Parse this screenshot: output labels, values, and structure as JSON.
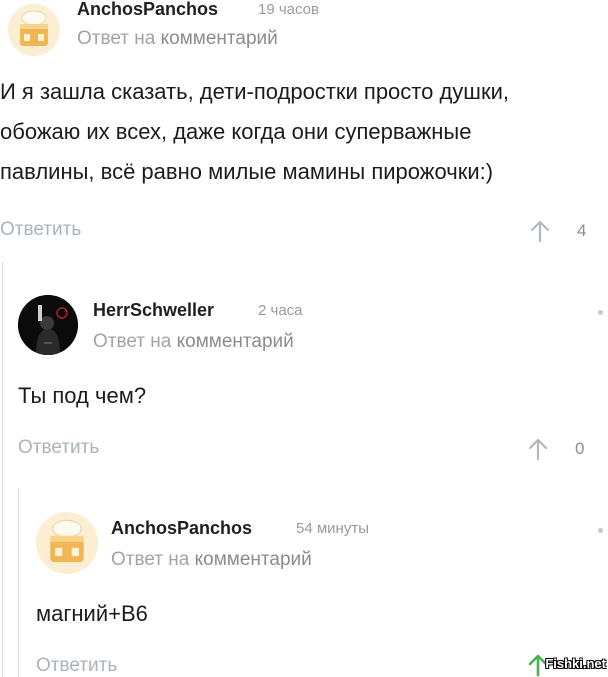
{
  "comments": [
    {
      "username": "AnchosPanchos",
      "time": "19 часов",
      "reply_prefix": "Ответ на ",
      "reply_link": "комментарий",
      "text_lines": [
        "И я зашла сказать, дети-подростки просто душки,",
        "обожаю их всех, даже когда они суперважные",
        "павлины, всё равно милые мамины пирожочки:)"
      ],
      "reply_label": "Ответить",
      "votes": "4",
      "avatar_icon": "cake-avatar-icon"
    },
    {
      "username": "HerrSchweller",
      "time": "2 часа",
      "reply_prefix": "Ответ на ",
      "reply_link": "комментарий",
      "text_lines": [
        "Ты под чем?"
      ],
      "reply_label": "Ответить",
      "votes": "0",
      "avatar_icon": "hooded-figure-avatar-icon"
    },
    {
      "username": "AnchosPanchos",
      "time": "54 минуты",
      "reply_prefix": "Ответ на ",
      "reply_link": "комментарий",
      "text_lines": [
        "магний+В6"
      ],
      "reply_label": "Ответить",
      "avatar_icon": "cake-avatar-icon"
    }
  ],
  "watermark": "Fishki.net",
  "colors": {
    "action_text": "#a9b3bd",
    "vote_arrow": "#b0b8c0",
    "vote_arrow_active": "#4caf50",
    "thread_line": "#dcdcdc"
  }
}
